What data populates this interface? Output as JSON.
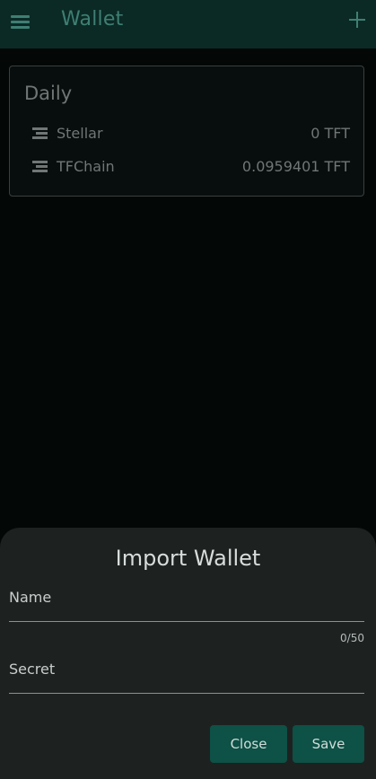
{
  "appbar": {
    "title": "Wallet"
  },
  "wallet_card": {
    "name": "Daily",
    "rows": [
      {
        "chain": "Stellar",
        "balance": "0 TFT"
      },
      {
        "chain": "TFChain",
        "balance": "0.0959401 TFT"
      }
    ]
  },
  "import_dialog": {
    "title": "Import Wallet",
    "name_label": "Name",
    "name_value": "",
    "name_counter": "0/50",
    "secret_label": "Secret",
    "secret_value": "",
    "close_label": "Close",
    "save_label": "Save"
  },
  "colors": {
    "appbar_bg": "#0b2a25",
    "accent": "#3f7f73",
    "button_bg": "#0e5146",
    "sheet_bg": "#1d2221"
  }
}
